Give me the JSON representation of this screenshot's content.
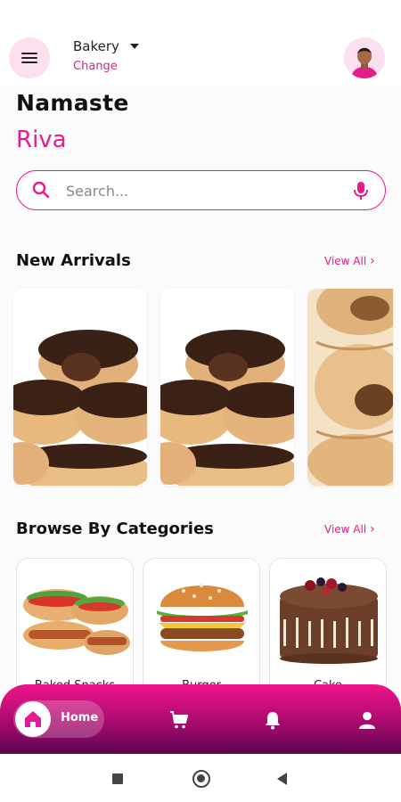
{
  "header": {
    "store_name": "Bakery",
    "change_label": "Change"
  },
  "greeting": {
    "title": "Namaste",
    "user_name": "Riva"
  },
  "search": {
    "placeholder": "Search..."
  },
  "new_arrivals": {
    "title": "New Arrivals",
    "view_all": "View All",
    "items": [
      {
        "image": "chocolate-donuts"
      },
      {
        "image": "chocolate-donuts"
      },
      {
        "image": "puff-pastry"
      }
    ]
  },
  "categories": {
    "title": "Browse By Categories",
    "view_all": "View All",
    "items": [
      {
        "label": "Baked Snacks",
        "image": "hot-dogs"
      },
      {
        "label": "Burger",
        "image": "burger"
      },
      {
        "label": "Cake",
        "image": "chocolate-cake"
      }
    ]
  },
  "bottom_nav": {
    "home_label": "Home",
    "items": [
      "home-icon",
      "cart-icon",
      "notification-icon",
      "profile-icon"
    ]
  },
  "colors": {
    "accent": "#e61c8c",
    "nav_gradient_top": "#f0158a",
    "nav_gradient_bottom": "#5c0652"
  }
}
